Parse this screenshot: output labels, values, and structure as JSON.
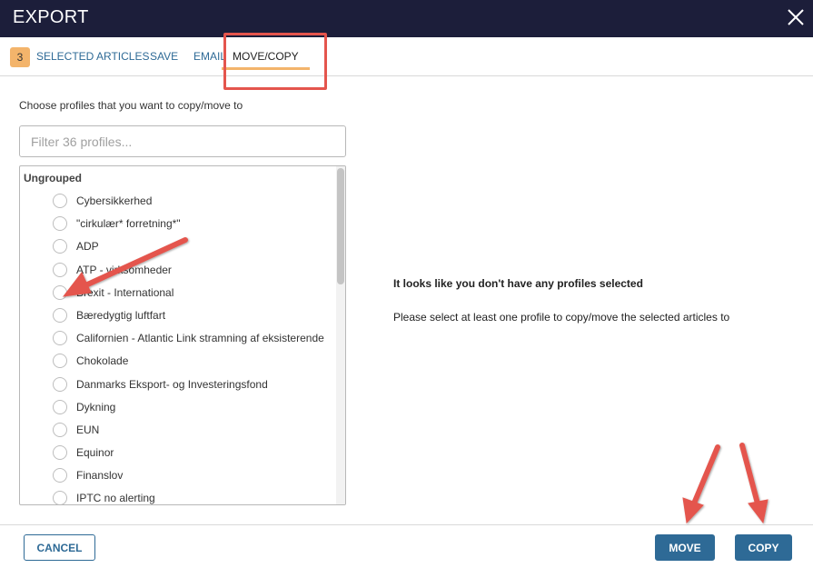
{
  "header": {
    "title": "EXPORT"
  },
  "tabs": {
    "badge": "3",
    "items": [
      {
        "label": "SELECTED ARTICLES"
      },
      {
        "label": "SAVE"
      },
      {
        "label": "EMAIL"
      },
      {
        "label": "MOVE/COPY"
      }
    ]
  },
  "panel": {
    "prompt": "Choose profiles that you want to copy/move to",
    "filter_placeholder": "Filter 36 profiles...",
    "group": "Ungrouped",
    "profiles": [
      "Cybersikkerhed",
      "\"cirkulær* forretning*\"",
      "ADP",
      "ATP - virksomheder",
      "Brexit - International",
      "Bæredygtig luftfart",
      "Californien - Atlantic Link stramning af eksisterende",
      "Chokolade",
      "Danmarks Eksport- og Investeringsfond",
      "Dykning",
      "EUN",
      "Equinor",
      "Finanslov",
      "IPTC no alerting"
    ]
  },
  "message": {
    "title": "It looks like you don't have any profiles selected",
    "body": "Please select at least one profile to copy/move the selected articles to"
  },
  "footer": {
    "cancel": "CANCEL",
    "move": "MOVE",
    "copy": "COPY"
  },
  "colors": {
    "header_bg": "#1c1e3a",
    "accent": "#f3b46b",
    "primary": "#2e6a96",
    "annotation": "#e4554d"
  }
}
